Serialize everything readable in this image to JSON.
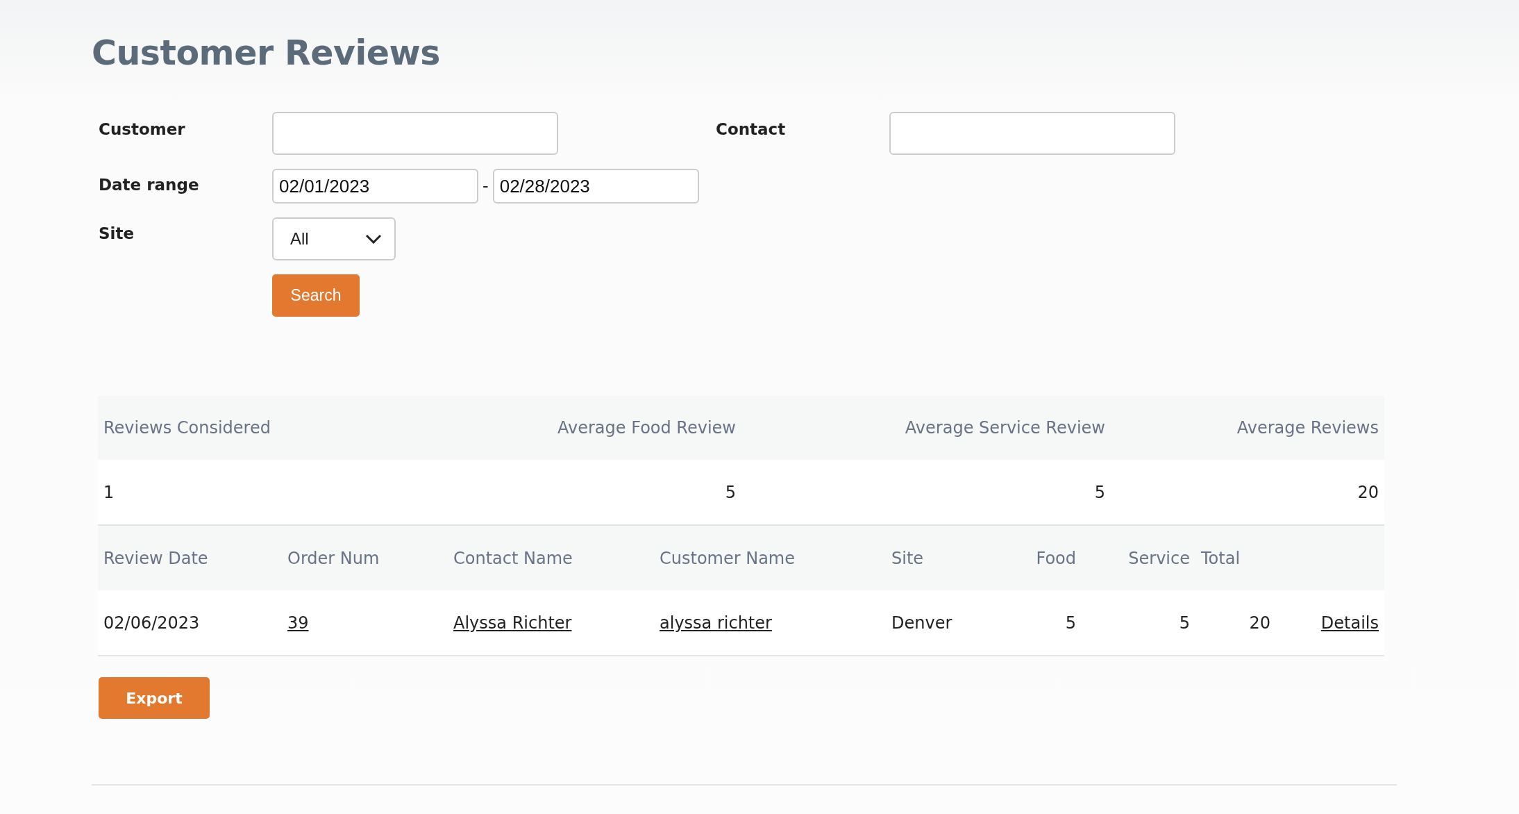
{
  "title": "Customer Reviews",
  "filters": {
    "customer": {
      "label": "Customer"
    },
    "contact": {
      "label": "Contact"
    },
    "date_range": {
      "label": "Date range",
      "from": "02/01/2023",
      "separator": "-",
      "to": "02/28/2023"
    },
    "site": {
      "label": "Site",
      "value": "All"
    },
    "search_button": "Search"
  },
  "summary": {
    "columns": [
      "Reviews Considered",
      "Average Food Review",
      "Average Service Review",
      "Average Reviews"
    ],
    "values": [
      "1",
      "5",
      "5",
      "20"
    ]
  },
  "table": {
    "columns": [
      "Review Date",
      "Order Num",
      "Contact Name",
      "Customer Name",
      "Site",
      "Food",
      "Service",
      "Total",
      ""
    ],
    "rows": [
      [
        {
          "text": "02/06/2023",
          "link": false
        },
        {
          "text": "39",
          "link": true
        },
        {
          "text": "Alyssa Richter",
          "link": true
        },
        {
          "text": "alyssa richter",
          "link": true
        },
        {
          "text": "Denver",
          "link": false
        },
        {
          "text": "5",
          "link": false
        },
        {
          "text": "5",
          "link": false
        },
        {
          "text": "20",
          "link": false
        },
        {
          "text": "Details",
          "link": true
        }
      ]
    ]
  },
  "export_button": "Export"
}
